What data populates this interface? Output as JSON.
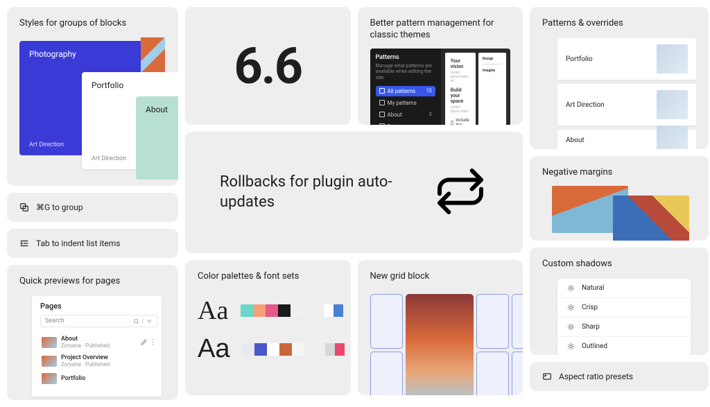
{
  "col1": {
    "styles_title": "Styles for groups of blocks",
    "cards": {
      "blue": "Photography",
      "blue_sub": "Art Direction",
      "white": "Portfolio",
      "white_sub": "Art Direction",
      "mint": "About"
    },
    "group_shortcut": "⌘G to group",
    "tab_indent": "Tab to indent list items",
    "quick_title": "Quick previews for pages",
    "pages": {
      "header": "Pages",
      "search": "Search",
      "rows": [
        {
          "title": "About",
          "meta": "Zoryana · Published"
        },
        {
          "title": "Project Overview",
          "meta": "Zoryana · Published"
        },
        {
          "title": "Portfolio",
          "meta": ""
        }
      ]
    }
  },
  "col2": {
    "version": "6.6",
    "pattern_mgmt_title": "Better pattern management for classic themes",
    "pm": {
      "hdr": "Patterns",
      "desc": "Manage what patterns are available when editing the site.",
      "items": [
        {
          "label": "All patterns",
          "count": "15",
          "active": true
        },
        {
          "label": "My patterns",
          "count": ""
        },
        {
          "label": "About",
          "count": "3"
        },
        {
          "label": "Footers",
          "count": ""
        }
      ],
      "doc1": {
        "h": "Your vision",
        "p": "Lorem ipsum dolor sit",
        "h2": "Build your space",
        "p2": "Lorem ipsum dolor"
      },
      "doc2": {
        "a": "Design",
        "b": "Imagine"
      },
      "chk": "Include this"
    },
    "rollback_text": "Rollbacks for plugin auto-updates",
    "palette_title": "Color palettes & font sets",
    "aa_serif": "Aa",
    "aa_sans": "Aa",
    "grid_title": "New grid block"
  },
  "col3": {
    "overrides_title": "Patterns & overrides",
    "ov_items": [
      "Portfolio",
      "Art Direction",
      "About"
    ],
    "neg_title": "Negative margins",
    "shadow_title": "Custom shadows",
    "shadows": [
      "Natural",
      "Crisp",
      "Sharp",
      "Outlined"
    ],
    "aspect": "Aspect ratio presets"
  },
  "palettes": {
    "row1": [
      "#6ad6c8",
      "#f5a078",
      "#e8588a",
      "#1a1a1a",
      "#f0f0f0"
    ],
    "row1b": [
      "#ffffff",
      "#4a7fd6"
    ],
    "row2": [
      "#e8e8f0",
      "#4858c8",
      "#ffffff",
      "#c8663a",
      "#f5f5f5"
    ],
    "row2b": [
      "#d8d8d8",
      "#e8486a"
    ]
  }
}
